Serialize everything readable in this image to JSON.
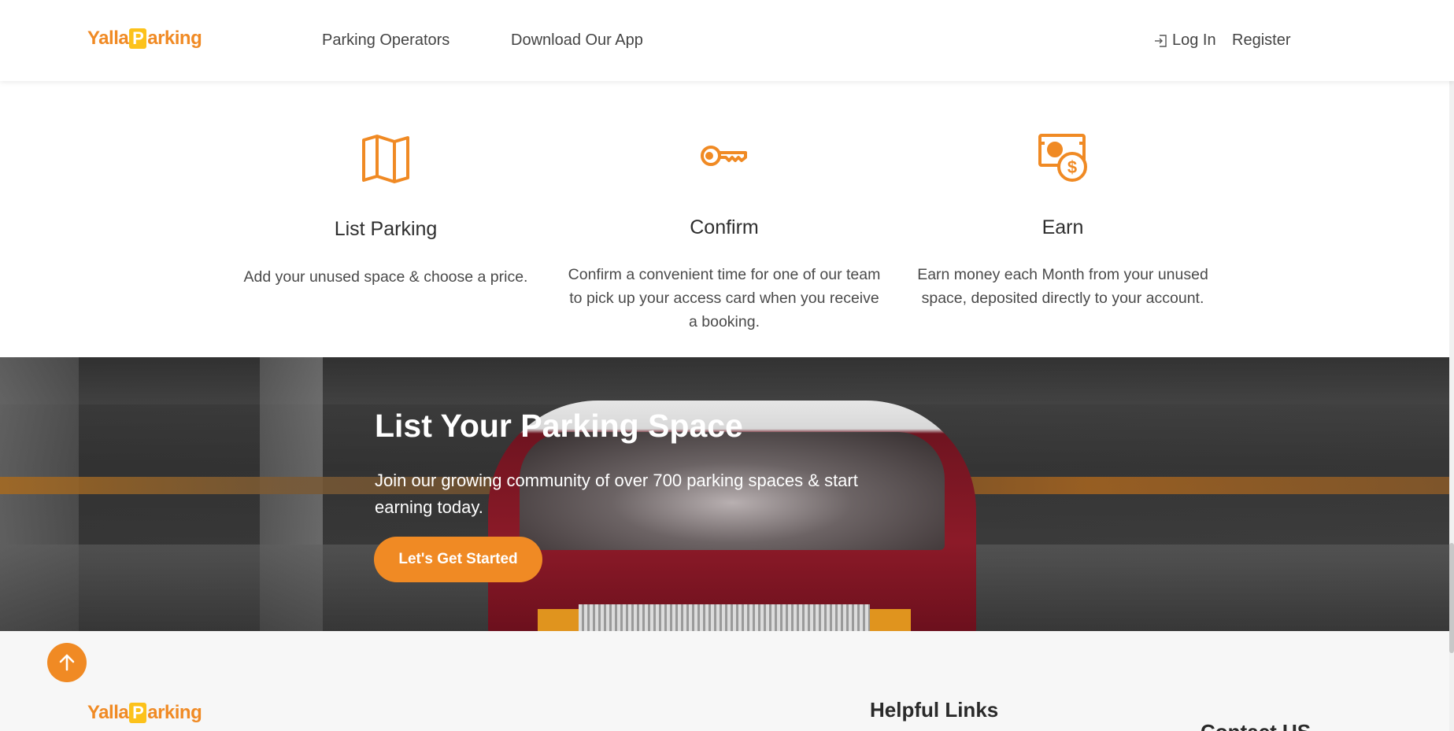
{
  "brand": {
    "name_prefix": "Yalla",
    "name_p": "P",
    "name_suffix": "arking",
    "accent": "#f08a24",
    "p_box": "#fcc21b"
  },
  "nav": {
    "parking_operators": "Parking Operators",
    "download_app": "Download Our App",
    "login": "Log In",
    "register": "Register"
  },
  "features": [
    {
      "icon": "map-icon",
      "title": "List Parking",
      "description": "Add your unused space & choose a price."
    },
    {
      "icon": "key-icon",
      "title": "Confirm",
      "description": "Confirm a convenient time for one of our team to pick up your access card when you receive a booking."
    },
    {
      "icon": "money-icon",
      "title": "Earn",
      "description": "Earn money each Month from your unused space, deposited directly to your account."
    }
  ],
  "banner": {
    "title": "List Your Parking Space",
    "description": "Join our growing community of over 700 parking spaces & start earning today.",
    "cta": "Let's Get Started"
  },
  "footer": {
    "helpful_links": "Helpful Links",
    "contact_us": "Contact US"
  }
}
